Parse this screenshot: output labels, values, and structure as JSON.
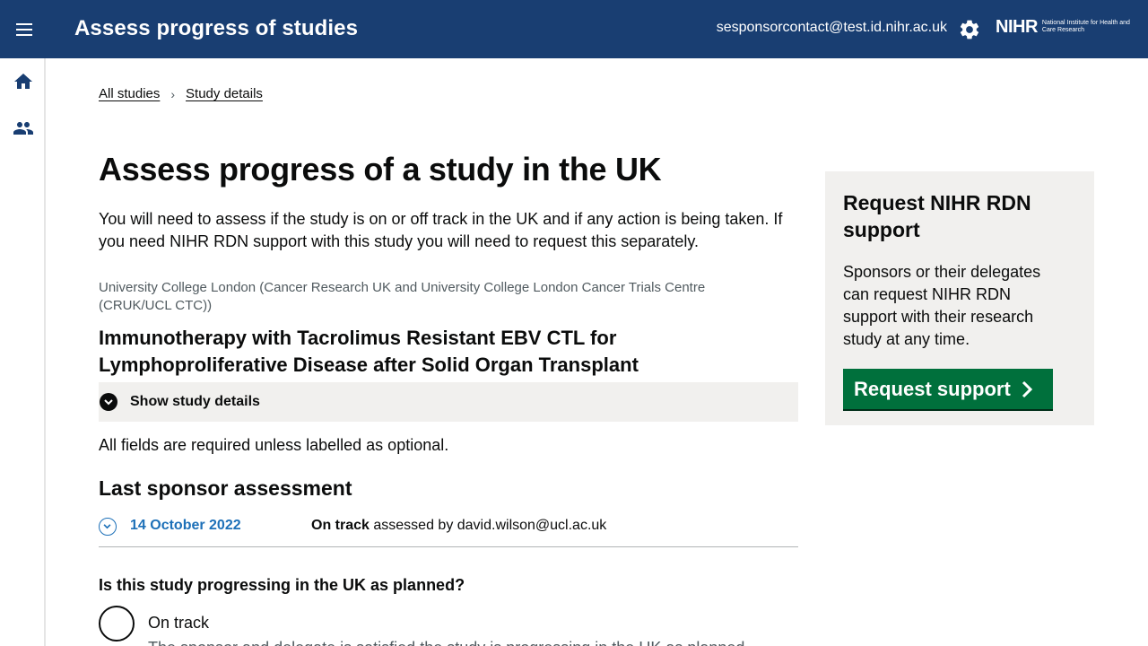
{
  "header": {
    "title": "Assess progress of studies",
    "user_email": "sesponsorcontact@test.id.nihr.ac.uk",
    "logo_mark": "NIHR",
    "logo_text": "National Institute for Health and Care Research",
    "menu_icon": "hamburger-icon",
    "settings_icon": "gear-icon"
  },
  "sidebar": {
    "items": [
      {
        "icon": "home-icon"
      },
      {
        "icon": "people-icon"
      }
    ]
  },
  "breadcrumbs": [
    {
      "label": "All studies"
    },
    {
      "label": "Study details"
    }
  ],
  "main": {
    "title": "Assess progress of a study in the UK",
    "lead": "You will need to assess if the study is on or off track in the UK and if any action is being taken. If you need NIHR RDN support with this study you will need to request this separately.",
    "organisation": "University College London (Cancer Research UK and University College London Cancer Trials Centre (CRUK/UCL CTC))",
    "study_title": "Immunotherapy with Tacrolimus Resistant EBV CTL for Lymphoproliferative Disease after Solid Organ Transplant",
    "show_details_label": "Show study details",
    "required_note": "All fields are required unless labelled as optional.",
    "last_assessment_heading": "Last sponsor assessment",
    "last_assessment": {
      "date": "14 October 2022",
      "status": "On track",
      "assessed_by_text": "assessed by david.wilson@ucl.ac.uk"
    },
    "question": "Is this study progressing in the UK as planned?",
    "options": [
      {
        "label": "On track",
        "hint": "The sponsor and delegate is satisfied the study is progressing in the UK as planned."
      }
    ]
  },
  "aside": {
    "heading": "Request NIHR RDN support",
    "body": "Sponsors or their delegates can request NIHR RDN support with their research study at any time.",
    "button_label": "Request support"
  },
  "colors": {
    "header_bg": "#193e72",
    "link_blue": "#1d70b8",
    "button_green": "#00703c",
    "panel_grey": "#f1f0ee"
  }
}
